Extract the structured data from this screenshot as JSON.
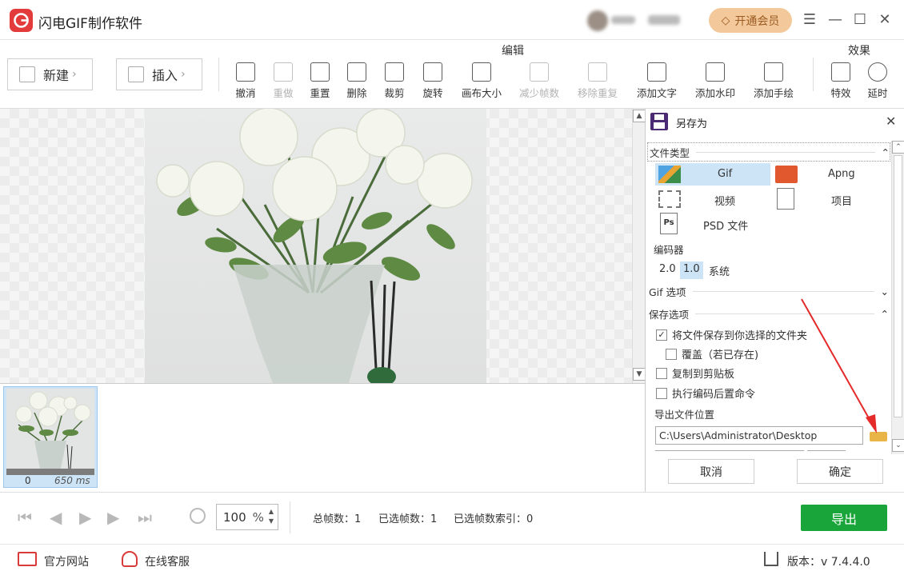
{
  "app": {
    "title": "闪电GIF制作软件"
  },
  "header": {
    "vip_label": "开通会员"
  },
  "toolbar": {
    "new_label": "新建",
    "insert_label": "插入",
    "group_edit": "编辑",
    "group_effect": "效果",
    "tools": [
      {
        "label": "撤消",
        "icon": "undo-icon"
      },
      {
        "label": "重做",
        "icon": "redo-icon"
      },
      {
        "label": "重置",
        "icon": "reset-icon"
      },
      {
        "label": "删除",
        "icon": "delete-icon"
      },
      {
        "label": "裁剪",
        "icon": "crop-icon"
      },
      {
        "label": "旋转",
        "icon": "rotate-icon"
      },
      {
        "label": "画布大小",
        "icon": "canvas-size-icon"
      },
      {
        "label": "减少帧数",
        "icon": "reduce-frames-icon"
      },
      {
        "label": "移除重复",
        "icon": "remove-duplicates-icon"
      },
      {
        "label": "添加文字",
        "icon": "add-text-icon"
      },
      {
        "label": "添加水印",
        "icon": "add-watermark-icon"
      },
      {
        "label": "添加手绘",
        "icon": "add-drawing-icon"
      },
      {
        "label": "特效",
        "icon": "effects-icon"
      },
      {
        "label": "延时",
        "icon": "delay-icon"
      }
    ]
  },
  "frames": [
    {
      "index": "0",
      "duration": "650 ms"
    }
  ],
  "save_panel": {
    "title": "另存为",
    "file_type_header": "文件类型",
    "types": [
      {
        "label": "Gif",
        "selected": true
      },
      {
        "label": "Apng",
        "selected": false
      },
      {
        "label": "视频",
        "selected": false
      },
      {
        "label": "项目",
        "selected": false
      },
      {
        "label": "PSD 文件",
        "selected": false
      }
    ],
    "encoder_header": "编码器",
    "encoders": [
      {
        "label": "2.0",
        "selected": false
      },
      {
        "label": "1.0",
        "selected": true
      },
      {
        "label": "系统",
        "selected": false
      }
    ],
    "gif_options_header": "Gif 选项",
    "save_options_header": "保存选项",
    "options": {
      "save_to_folder": "将文件保存到你选择的文件夹",
      "overwrite": "覆盖（若已存在)",
      "copy_clipboard": "复制到剪贴板",
      "run_post_command": "执行编码后置命令"
    },
    "export_location_label": "导出文件位置",
    "export_path": "C:\\Users\\Administrator\\Desktop",
    "cancel_label": "取消",
    "confirm_label": "确定"
  },
  "bottom": {
    "zoom_value": "100",
    "zoom_unit": "%",
    "total_frames": "总帧数：1",
    "selected_frames": "已选帧数：1",
    "selected_index": "已选帧数索引：0",
    "export_label": "导出"
  },
  "status": {
    "website": "官方网站",
    "support": "在线客服",
    "version": "版本：v 7.4.4.0"
  },
  "colors": {
    "brand_red": "#e33b3b",
    "export_green": "#1aa53b",
    "vip_gold": "#f3c99b",
    "selection_blue": "#cde4f7"
  }
}
